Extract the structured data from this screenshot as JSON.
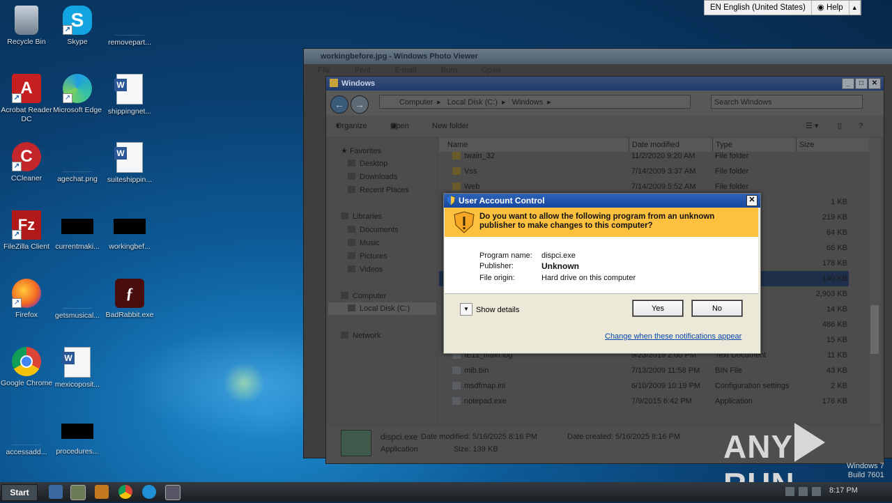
{
  "topbar": {
    "language": "EN English (United States)",
    "help": "Help"
  },
  "desktop_icons": [
    {
      "label": "Recycle Bin",
      "icon": "recycle-bin-icon"
    },
    {
      "label": "Skype",
      "icon": "skype-icon"
    },
    {
      "label": "removepart...",
      "icon": "file-icon"
    },
    {
      "label": "Acrobat Reader DC",
      "icon": "acrobat-icon"
    },
    {
      "label": "Microsoft Edge",
      "icon": "edge-icon"
    },
    {
      "label": "shippingnet...",
      "icon": "word-doc-icon"
    },
    {
      "label": "CCleaner",
      "icon": "ccleaner-icon"
    },
    {
      "label": "agechat.png",
      "icon": "image-file-icon"
    },
    {
      "label": "suiteshippin...",
      "icon": "word-doc-icon"
    },
    {
      "label": "FileZilla Client",
      "icon": "filezilla-icon"
    },
    {
      "label": "currentmaki...",
      "icon": "file-icon"
    },
    {
      "label": "workingbef...",
      "icon": "file-icon"
    },
    {
      "label": "Firefox",
      "icon": "firefox-icon"
    },
    {
      "label": "getsmusical...",
      "icon": "file-icon"
    },
    {
      "label": "BadRabbit.exe",
      "icon": "flash-exe-icon"
    },
    {
      "label": "Google Chrome",
      "icon": "chrome-icon"
    },
    {
      "label": "mexicoposit...",
      "icon": "word-doc-icon"
    },
    {
      "label": "accessadd...",
      "icon": "file-icon"
    },
    {
      "label": "procedures...",
      "icon": "file-icon"
    }
  ],
  "photo_viewer": {
    "title": "workingbefore.jpg - Windows Photo Viewer",
    "menu": [
      "File",
      "Print",
      "E-mail",
      "Burn",
      "Open"
    ]
  },
  "explorer": {
    "title": "Windows",
    "breadcrumb": [
      "Computer",
      "Local Disk (C:)",
      "Windows"
    ],
    "search_placeholder": "Search Windows",
    "toolbar": {
      "organize": "Organize",
      "open": "Open",
      "new_folder": "New folder"
    },
    "nav": {
      "favorites": "Favorites",
      "desktop": "Desktop",
      "downloads": "Downloads",
      "recent": "Recent Places",
      "libraries": "Libraries",
      "documents": "Documents",
      "music": "Music",
      "pictures": "Pictures",
      "videos": "Videos",
      "computer": "Computer",
      "local_disk": "Local Disk (C:)",
      "network": "Network"
    },
    "columns": {
      "name": "Name",
      "date": "Date modified",
      "type": "Type",
      "size": "Size"
    },
    "rows": [
      {
        "name": "twain_32",
        "date": "11/2/2020 9:20 AM",
        "type": "File folder",
        "size": ""
      },
      {
        "name": "Vss",
        "date": "7/14/2009 3:37 AM",
        "type": "File folder",
        "size": ""
      },
      {
        "name": "Web",
        "date": "7/14/2009 5:52 AM",
        "type": "File folder",
        "size": ""
      },
      {
        "name": "",
        "date": "",
        "type": "S-DOS...",
        "size": "1 KB"
      },
      {
        "name": "",
        "date": "",
        "type": "",
        "size": "219 KB"
      },
      {
        "name": "",
        "date": "",
        "type": "",
        "size": "64 KB"
      },
      {
        "name": "",
        "date": "",
        "type": "",
        "size": "66 KB"
      },
      {
        "name": "",
        "date": "",
        "type": "",
        "size": "178 KB"
      },
      {
        "name": "",
        "date": "",
        "type": "",
        "size": "140 KB"
      },
      {
        "name": "",
        "date": "",
        "type": "",
        "size": "2,903 KB"
      },
      {
        "name": "",
        "date": "",
        "type": "",
        "size": "14 KB"
      },
      {
        "name": "",
        "date": "",
        "type": "",
        "size": "486 KB"
      },
      {
        "name": "hh.exe",
        "date": "4/18/2018 4:35 PM",
        "type": "Application",
        "size": "15 KB"
      },
      {
        "name": "IE11_main.log",
        "date": "9/23/2019 2:00 PM",
        "type": "Text Document",
        "size": "11 KB"
      },
      {
        "name": "mib.bin",
        "date": "7/13/2009 11:58 PM",
        "type": "BIN File",
        "size": "43 KB"
      },
      {
        "name": "msdfmap.ini",
        "date": "6/10/2009 10:19 PM",
        "type": "Configuration settings",
        "size": "2 KB"
      },
      {
        "name": "notepad.exe",
        "date": "7/9/2015 6:42 PM",
        "type": "Application",
        "size": "176 KB"
      }
    ],
    "details": {
      "filename": "dispci.exe",
      "date_modified": "Date modified: 5/16/2025 8:16 PM",
      "date_created": "Date created: 5/16/2025 8:16 PM",
      "kind": "Application",
      "size": "Size: 139 KB"
    }
  },
  "uac": {
    "title": "User Account Control",
    "question_line1": "Do you want to allow the following program from an unknown",
    "question_line2": "publisher to make changes to this computer?",
    "program_name_label": "Program name:",
    "program_name": "dispci.exe",
    "publisher_label": "Publisher:",
    "publisher": "Unknown",
    "file_origin_label": "File origin:",
    "file_origin": "Hard drive on this computer",
    "show_details": "Show details",
    "yes": "Yes",
    "no": "No",
    "link": "Change when these notifications appear",
    "colors": {
      "warning_band": "#fdc13f",
      "caption": "#1946a0"
    }
  },
  "taskbar": {
    "start": "Start",
    "clock": "8:17 PM"
  },
  "watermark": {
    "left": "ANY",
    "right": "RUN"
  },
  "windows_version": {
    "line1": "Windows 7",
    "line2": "Build 7601"
  }
}
